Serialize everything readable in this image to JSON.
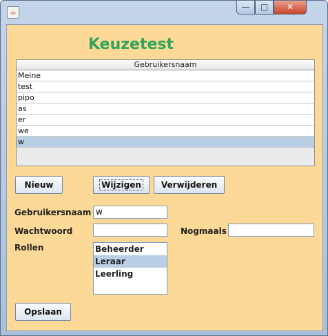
{
  "window": {
    "icon": "java-cup-icon",
    "controls": {
      "minimize": "—",
      "maximize": "□",
      "close": "✕"
    }
  },
  "app_title": "Keuzetest",
  "colors": {
    "title": "#32a45c",
    "background": "#fcd996",
    "selection": "#b8cfe5"
  },
  "table": {
    "header": "Gebruikersnaam",
    "rows": [
      "Meine",
      "test",
      "pipo",
      "as",
      "er",
      "we",
      "w"
    ],
    "selected_index": 6
  },
  "buttons": {
    "nieuw": "Nieuw",
    "wijzigen": "Wijzigen",
    "verwijderen": "Verwijderen",
    "opslaan": "Opslaan"
  },
  "form": {
    "gebruikersnaam_label": "Gebruikersnaam",
    "gebruikersnaam_value": "w",
    "wachtwoord_label": "Wachtwoord",
    "wachtwoord_value": "",
    "nogmaals_label": "Nogmaals",
    "nogmaals_value": "",
    "rollen_label": "Rollen",
    "rollen": [
      "Beheerder",
      "Leraar",
      "Leerling"
    ],
    "rollen_selected_index": 1
  }
}
